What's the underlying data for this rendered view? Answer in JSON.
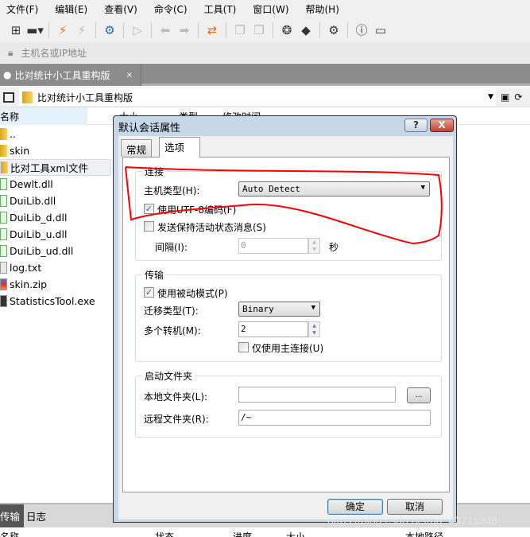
{
  "menu": [
    "文件(F)",
    "编辑(E)",
    "查看(V)",
    "命令(C)",
    "工具(T)",
    "窗口(W)",
    "帮助(H)"
  ],
  "toolbar_icons": [
    "new-session-icon",
    "open-folder-icon",
    "connect-icon",
    "disconnect-icon",
    "session-settings-icon",
    "play-icon",
    "back-icon",
    "forward-icon",
    "transfer-icon",
    "copy-icon",
    "paste-icon",
    "xshell-icon",
    "xftp-icon",
    "gear-icon",
    "help-icon",
    "feedback-icon"
  ],
  "address": {
    "placeholder": "主机名或IP地址"
  },
  "session_tab": {
    "label": "比对统计小工具重构版",
    "close": "×"
  },
  "path": {
    "value": "比对统计小工具重构版"
  },
  "columns": [
    "名称",
    "大小",
    "类型",
    "修改时间"
  ],
  "files": [
    {
      "name": "..",
      "type": "folder"
    },
    {
      "name": "skin",
      "type": "folder"
    },
    {
      "name": "比对工具xml文件",
      "type": "folder",
      "selected": true
    },
    {
      "name": "Dewlt.dll",
      "type": "dll"
    },
    {
      "name": "DuiLib.dll",
      "type": "dll"
    },
    {
      "name": "DuiLib_d.dll",
      "type": "dll"
    },
    {
      "name": "DuiLib_u.dll",
      "type": "dll"
    },
    {
      "name": "DuiLib_ud.dll",
      "type": "dll"
    },
    {
      "name": "log.txt",
      "type": "txt"
    },
    {
      "name": "skin.zip",
      "type": "zip"
    },
    {
      "name": "StatisticsTool.exe",
      "type": "exe"
    }
  ],
  "bottom_tabs": [
    "传输",
    "日志"
  ],
  "bottom_columns": [
    "名称",
    "状态",
    "进度",
    "大小",
    "本地路径"
  ],
  "watermark": "https://blog.csdn.net/qq_43711348",
  "dialog": {
    "title": "默认会话属性",
    "help": "?",
    "close": "X",
    "tabs": [
      "常规",
      "选项"
    ],
    "connection": {
      "legend": "连接",
      "host_type_label": "主机类型(H):",
      "host_type_value": "Auto Detect",
      "utf8_label": "使用UTF-8编码(F)",
      "utf8_checked": true,
      "keepalive_label": "发送保持活动状态消息(S)",
      "keepalive_checked": false,
      "interval_label": "间隔(I):",
      "interval_value": "0",
      "interval_unit": "秒"
    },
    "transfer": {
      "legend": "传输",
      "passive_label": "使用被动模式(P)",
      "passive_checked": true,
      "transfer_type_label": "迁移类型(T):",
      "transfer_type_value": "Binary",
      "multi_label": "多个转机(M):",
      "multi_value": "2",
      "primary_only_label": "仅使用主连接(U)",
      "primary_only_checked": false
    },
    "startup": {
      "legend": "启动文件夹",
      "local_label": "本地文件夹(L):",
      "local_value": "",
      "browse": "...",
      "remote_label": "远程文件夹(R):",
      "remote_value": "/~"
    },
    "ok": "确定",
    "cancel": "取消"
  },
  "annotation_color": "#ff0000"
}
